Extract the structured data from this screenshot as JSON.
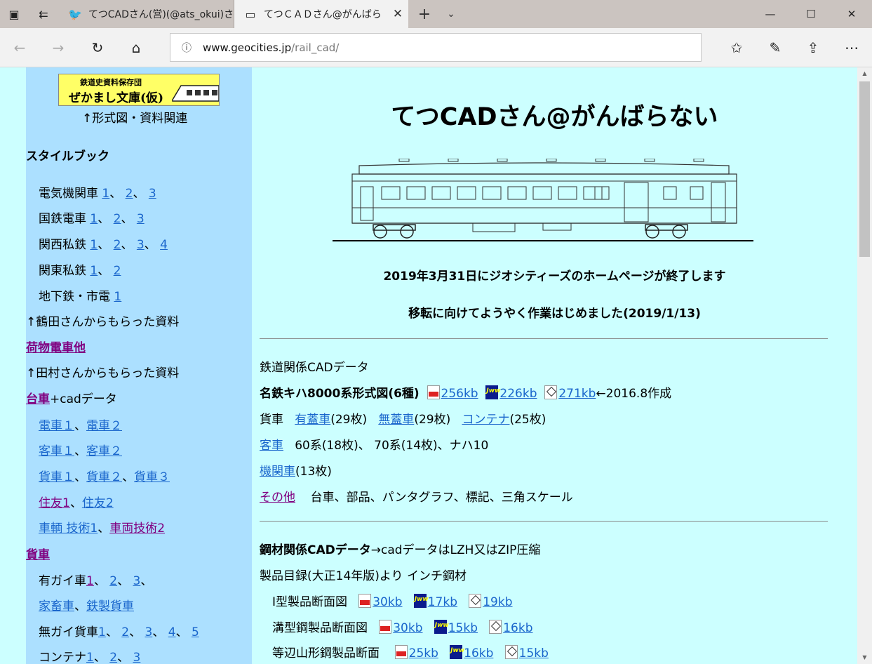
{
  "browser": {
    "tabs": [
      {
        "title": "てつCADさん(営)(@ats_okui)さ",
        "icon": "twitter-bird-icon",
        "active": false
      },
      {
        "title": "てつＣＡＤさん@がんばら",
        "icon": "page-icon",
        "active": true
      }
    ],
    "url_host": "www.geocities.jp",
    "url_path": "/rail_cad/"
  },
  "sidebar": {
    "banner_line1": "鉄道史資料保存団",
    "banner_line2": "ぜかまし文庫(仮)",
    "banner_caption": "↑形式図・資料関連",
    "stylebook_heading": "スタイルブック",
    "electric_loco": {
      "label": "電気機関車",
      "links": [
        "1",
        "2",
        "3"
      ]
    },
    "jnr_emu": {
      "label": "国鉄電車",
      "links": [
        "1",
        "2",
        "3"
      ]
    },
    "kansai_private": {
      "label": "関西私鉄",
      "links": [
        "1",
        "2",
        "3",
        "4"
      ]
    },
    "kanto_private": {
      "label": "関東私鉄",
      "links": [
        "1",
        "2"
      ]
    },
    "subway": {
      "label": "地下鉄・市電",
      "links": [
        "1"
      ]
    },
    "tsuruta_note": "↑鶴田さんからもらった資料",
    "baggage_link": "荷物電車他",
    "tamura_note": "↑田村さんからもらった資料",
    "bogie_link": "台車",
    "bogie_suffix": "+cadデータ",
    "emu_links": [
      "電車１",
      "電車２"
    ],
    "coach_links": [
      "客車１",
      "客車２"
    ],
    "freight_links": [
      "貨車１",
      "貨車２",
      "貨車３"
    ],
    "sumitomo_links": [
      "住友1",
      "住友2"
    ],
    "tech_links": [
      "車輌 技術1",
      "車両技術2"
    ],
    "freight_heading_link": "貨車",
    "covered_wagon": {
      "label": "有ガイ車",
      "links": [
        "1",
        "2",
        "3"
      ]
    },
    "livestock_links": [
      "家畜車",
      "鉄製貨車"
    ],
    "open_wagon": {
      "label": "無ガイ貨車",
      "links": [
        "1",
        "2",
        "3",
        "4",
        "5"
      ]
    },
    "container": {
      "label": "コンテナ",
      "links": [
        "1",
        "2",
        "3"
      ]
    }
  },
  "main": {
    "title": "てつCADさん@がんばらない",
    "notice1": "2019年3月31日にジオシティーズのホームページが終了します",
    "notice2": "移転に向けてようやく作業はじめました(2019/1/13)",
    "rail_cad_heading": "鉄道関係CADデータ",
    "meitetsu_label": "名鉄キハ8000系形式図(6種)",
    "meitetsu_pdf": "256kb",
    "meitetsu_jww": "226kb",
    "meitetsu_dxf": "271kb",
    "meitetsu_note": "←2016.8作成",
    "freight_label": "貨車",
    "covered_link": "有蓋車",
    "covered_count": "(29枚)",
    "open_link": "無蓋車",
    "open_count": "(29枚)",
    "container_link": "コンテナ",
    "container_count": "(25枚)",
    "coach_link": "客車",
    "coach_note": "60系(18枚)、 70系(14枚)、ナハ10",
    "loco_link": "機関車",
    "loco_count": "(13枚)",
    "other_link": "その他",
    "other_note": "台車、部品、パンタグラフ、標記、三角スケール",
    "steel_heading": "鋼材関係CADデータ",
    "steel_note": "→cadデータはLZH又はZIP圧縮",
    "catalog_line": "製品目録(大正14年版)より インチ鋼材",
    "steel_rows": [
      {
        "label": "I型製品断面図",
        "pdf": "30kb",
        "jww": "17kb",
        "dxf": "19kb"
      },
      {
        "label": "溝型鋼製品断面図",
        "pdf": "30kb",
        "jww": "15kb",
        "dxf": "16kb"
      },
      {
        "label": "等辺山形鋼製品断面",
        "pdf": "25kb",
        "jww": "16kb",
        "dxf": "15kb"
      }
    ]
  },
  "colors": {
    "page_bg": "#ccffff",
    "sidebar_bg": "#ace0ff",
    "link": "#1a66cc",
    "visited": "#800080",
    "banner_bg": "#ffff66"
  }
}
